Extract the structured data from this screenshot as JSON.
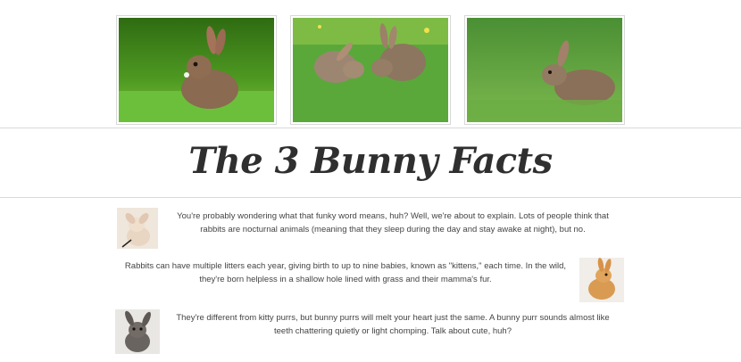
{
  "gallery": {
    "photos": [
      {
        "icon": "rabbit-grass-photo-icon"
      },
      {
        "icon": "two-rabbits-photo-icon"
      },
      {
        "icon": "rabbit-field-photo-icon"
      }
    ]
  },
  "header": {
    "title": "The 3 Bunny Facts"
  },
  "facts": [
    {
      "text": "You're probably wondering what that funky word means, huh? Well, we're about to explain. Lots of people think that rabbits are nocturnal animals (meaning that they sleep during the day and stay awake at night), but no.",
      "icon": "bunny-thumbnail-icon"
    },
    {
      "text": "Rabbits can have multiple litters each year, giving birth to up to nine babies, known as \"kittens,\" each time. In the wild, they're born helpless in a shallow hole lined with grass and their mamma's fur.",
      "icon": "bunny-thumbnail-icon"
    },
    {
      "text": "They're different from kitty purrs, but bunny purrs will melt your heart just the same. A bunny purr sounds almost like teeth chattering quietly or light chomping. Talk about cute, huh?",
      "icon": "bunny-thumbnail-icon"
    }
  ],
  "colors": {
    "title": "#2f2f2f",
    "text": "#444444",
    "rule": "#d9d9d9",
    "grass": "#5aa83a"
  }
}
